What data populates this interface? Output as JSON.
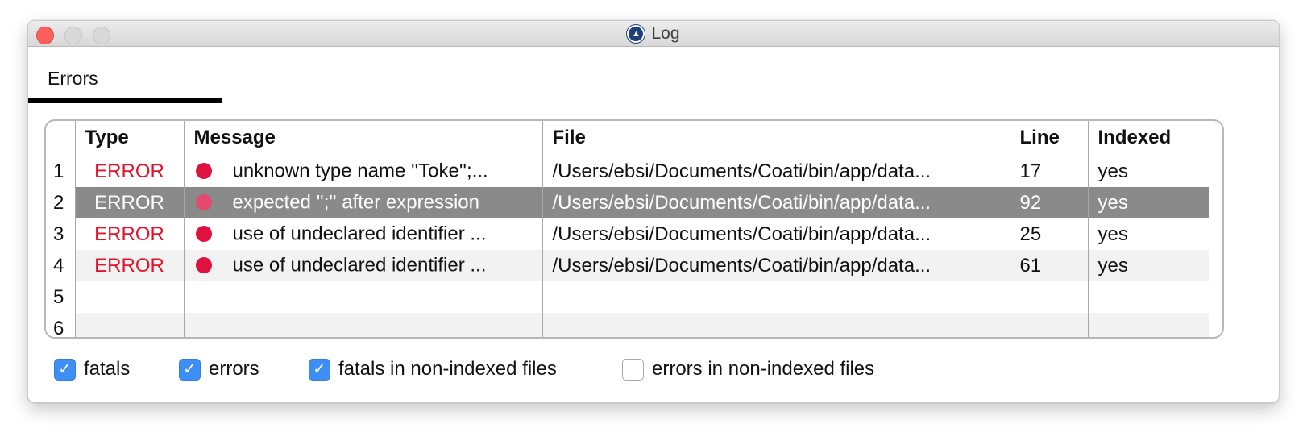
{
  "window": {
    "title": "Log"
  },
  "tabs": [
    {
      "label": "Errors"
    }
  ],
  "table": {
    "headers": {
      "type": "Type",
      "message": "Message",
      "file": "File",
      "line": "Line",
      "indexed": "Indexed"
    },
    "rows": [
      {
        "num": "1",
        "type": "ERROR",
        "message": "unknown type name ''Toke'';...",
        "file": "/Users/ebsi/Documents/Coati/bin/app/data...",
        "line": "17",
        "indexed": "yes"
      },
      {
        "num": "2",
        "type": "ERROR",
        "message": "expected '';'' after expression",
        "file": "/Users/ebsi/Documents/Coati/bin/app/data...",
        "line": "92",
        "indexed": "yes"
      },
      {
        "num": "3",
        "type": "ERROR",
        "message": "use of undeclared identifier ...",
        "file": "/Users/ebsi/Documents/Coati/bin/app/data...",
        "line": "25",
        "indexed": "yes"
      },
      {
        "num": "4",
        "type": "ERROR",
        "message": "use of undeclared identifier ...",
        "file": "/Users/ebsi/Documents/Coati/bin/app/data...",
        "line": "61",
        "indexed": "yes"
      },
      {
        "num": "5",
        "type": "",
        "message": "",
        "file": "",
        "line": "",
        "indexed": ""
      },
      {
        "num": "6",
        "type": "",
        "message": "",
        "file": "",
        "line": "",
        "indexed": ""
      }
    ],
    "selected_row": 2
  },
  "filters": [
    {
      "label": "fatals",
      "checked": true
    },
    {
      "label": "errors",
      "checked": true
    },
    {
      "label": "fatals in non-indexed files",
      "checked": true
    },
    {
      "label": "errors in non-indexed files",
      "checked": false
    }
  ],
  "colors": {
    "error_text": "#e3132b",
    "error_dot": "#e0103f",
    "selection_bg": "#8a8a8a",
    "checkbox_blue": "#3d8ef5"
  },
  "icons": {
    "app": "coati-logo-icon",
    "error_marker": "error-dot-icon",
    "check": "checkmark-icon"
  }
}
